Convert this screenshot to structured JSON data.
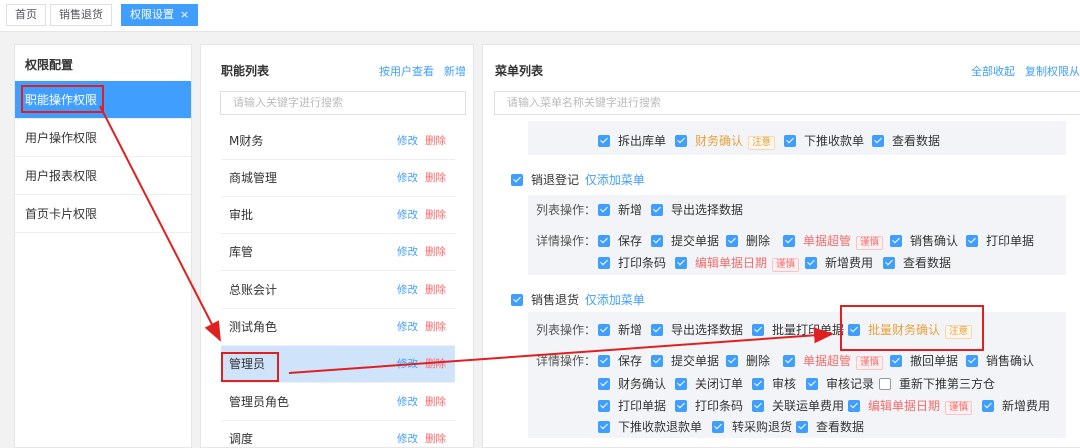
{
  "tabs": [
    {
      "label": "首页"
    },
    {
      "label": "销售退货"
    },
    {
      "label": "权限设置",
      "close": "×"
    }
  ],
  "left": {
    "title": "权限配置",
    "items": [
      "职能操作权限",
      "用户操作权限",
      "用户报表权限",
      "首页卡片权限"
    ]
  },
  "roles": {
    "title": "职能列表",
    "link_user": "按用户查看",
    "link_add": "新增",
    "search_placeholder": "请输入关键字进行搜索",
    "edit": "修改",
    "delete": "删除",
    "items": [
      "M财务",
      "商城管理",
      "审批",
      "库管",
      "总账会计",
      "测试角色",
      "管理员",
      "管理员角色",
      "调度"
    ]
  },
  "menus": {
    "title": "菜单列表",
    "collapse_all": "全部收起",
    "copy": "复制权限从",
    "search_placeholder": "请输入菜单名称关键字进行搜索",
    "top_row": [
      {
        "label": "拆出库单"
      },
      {
        "label": "财务确认",
        "tag": "注意"
      },
      {
        "label": "下推收款单"
      },
      {
        "label": "查看数据"
      }
    ],
    "sec1": {
      "name": "销退登记",
      "only_add": "仅添加菜单",
      "list_label": "列表操作：",
      "list": [
        "新增",
        "导出选择数据"
      ],
      "detail_label": "详情操作：",
      "d1": [
        {
          "label": "保存"
        },
        {
          "label": "提交单据"
        },
        {
          "label": "删除"
        },
        {
          "label": "单据超管",
          "tag": "谨慎"
        },
        {
          "label": "销售确认"
        },
        {
          "label": "打印单据"
        }
      ],
      "d2": [
        {
          "label": "打印条码"
        },
        {
          "label": "编辑单据日期",
          "tag": "谨慎"
        },
        {
          "label": "新增费用"
        },
        {
          "label": "查看数据"
        }
      ]
    },
    "sec2": {
      "name": "销售退货",
      "only_add": "仅添加菜单",
      "list_label": "列表操作：",
      "list": [
        "新增",
        "导出选择数据",
        "批量打印单据"
      ],
      "list_warn": {
        "label": "批量财务确认",
        "tag": "注意"
      },
      "detail_label": "详情操作：",
      "d1": [
        {
          "label": "保存"
        },
        {
          "label": "提交单据"
        },
        {
          "label": "删除"
        },
        {
          "label": "单据超管",
          "tag": "谨慎"
        },
        {
          "label": "撤回单据"
        },
        {
          "label": "销售确认"
        }
      ],
      "d2": [
        {
          "label": "财务确认"
        },
        {
          "label": "关闭订单"
        },
        {
          "label": "审核"
        },
        {
          "label": "审核记录"
        },
        {
          "label": "重新下推第三方仓"
        }
      ],
      "d3": [
        {
          "label": "打印单据"
        },
        {
          "label": "打印条码"
        },
        {
          "label": "关联运单费用"
        },
        {
          "label": "编辑单据日期",
          "tag": "谨慎"
        },
        {
          "label": "新增费用"
        }
      ],
      "d4": [
        {
          "label": "下推收款退款单"
        },
        {
          "label": "转采购退货"
        },
        {
          "label": "查看数据"
        }
      ]
    }
  },
  "colors": {
    "primary": "#409eff",
    "danger": "#f56c6c",
    "warn": "#e6a23c",
    "annotation": "#e02020"
  }
}
